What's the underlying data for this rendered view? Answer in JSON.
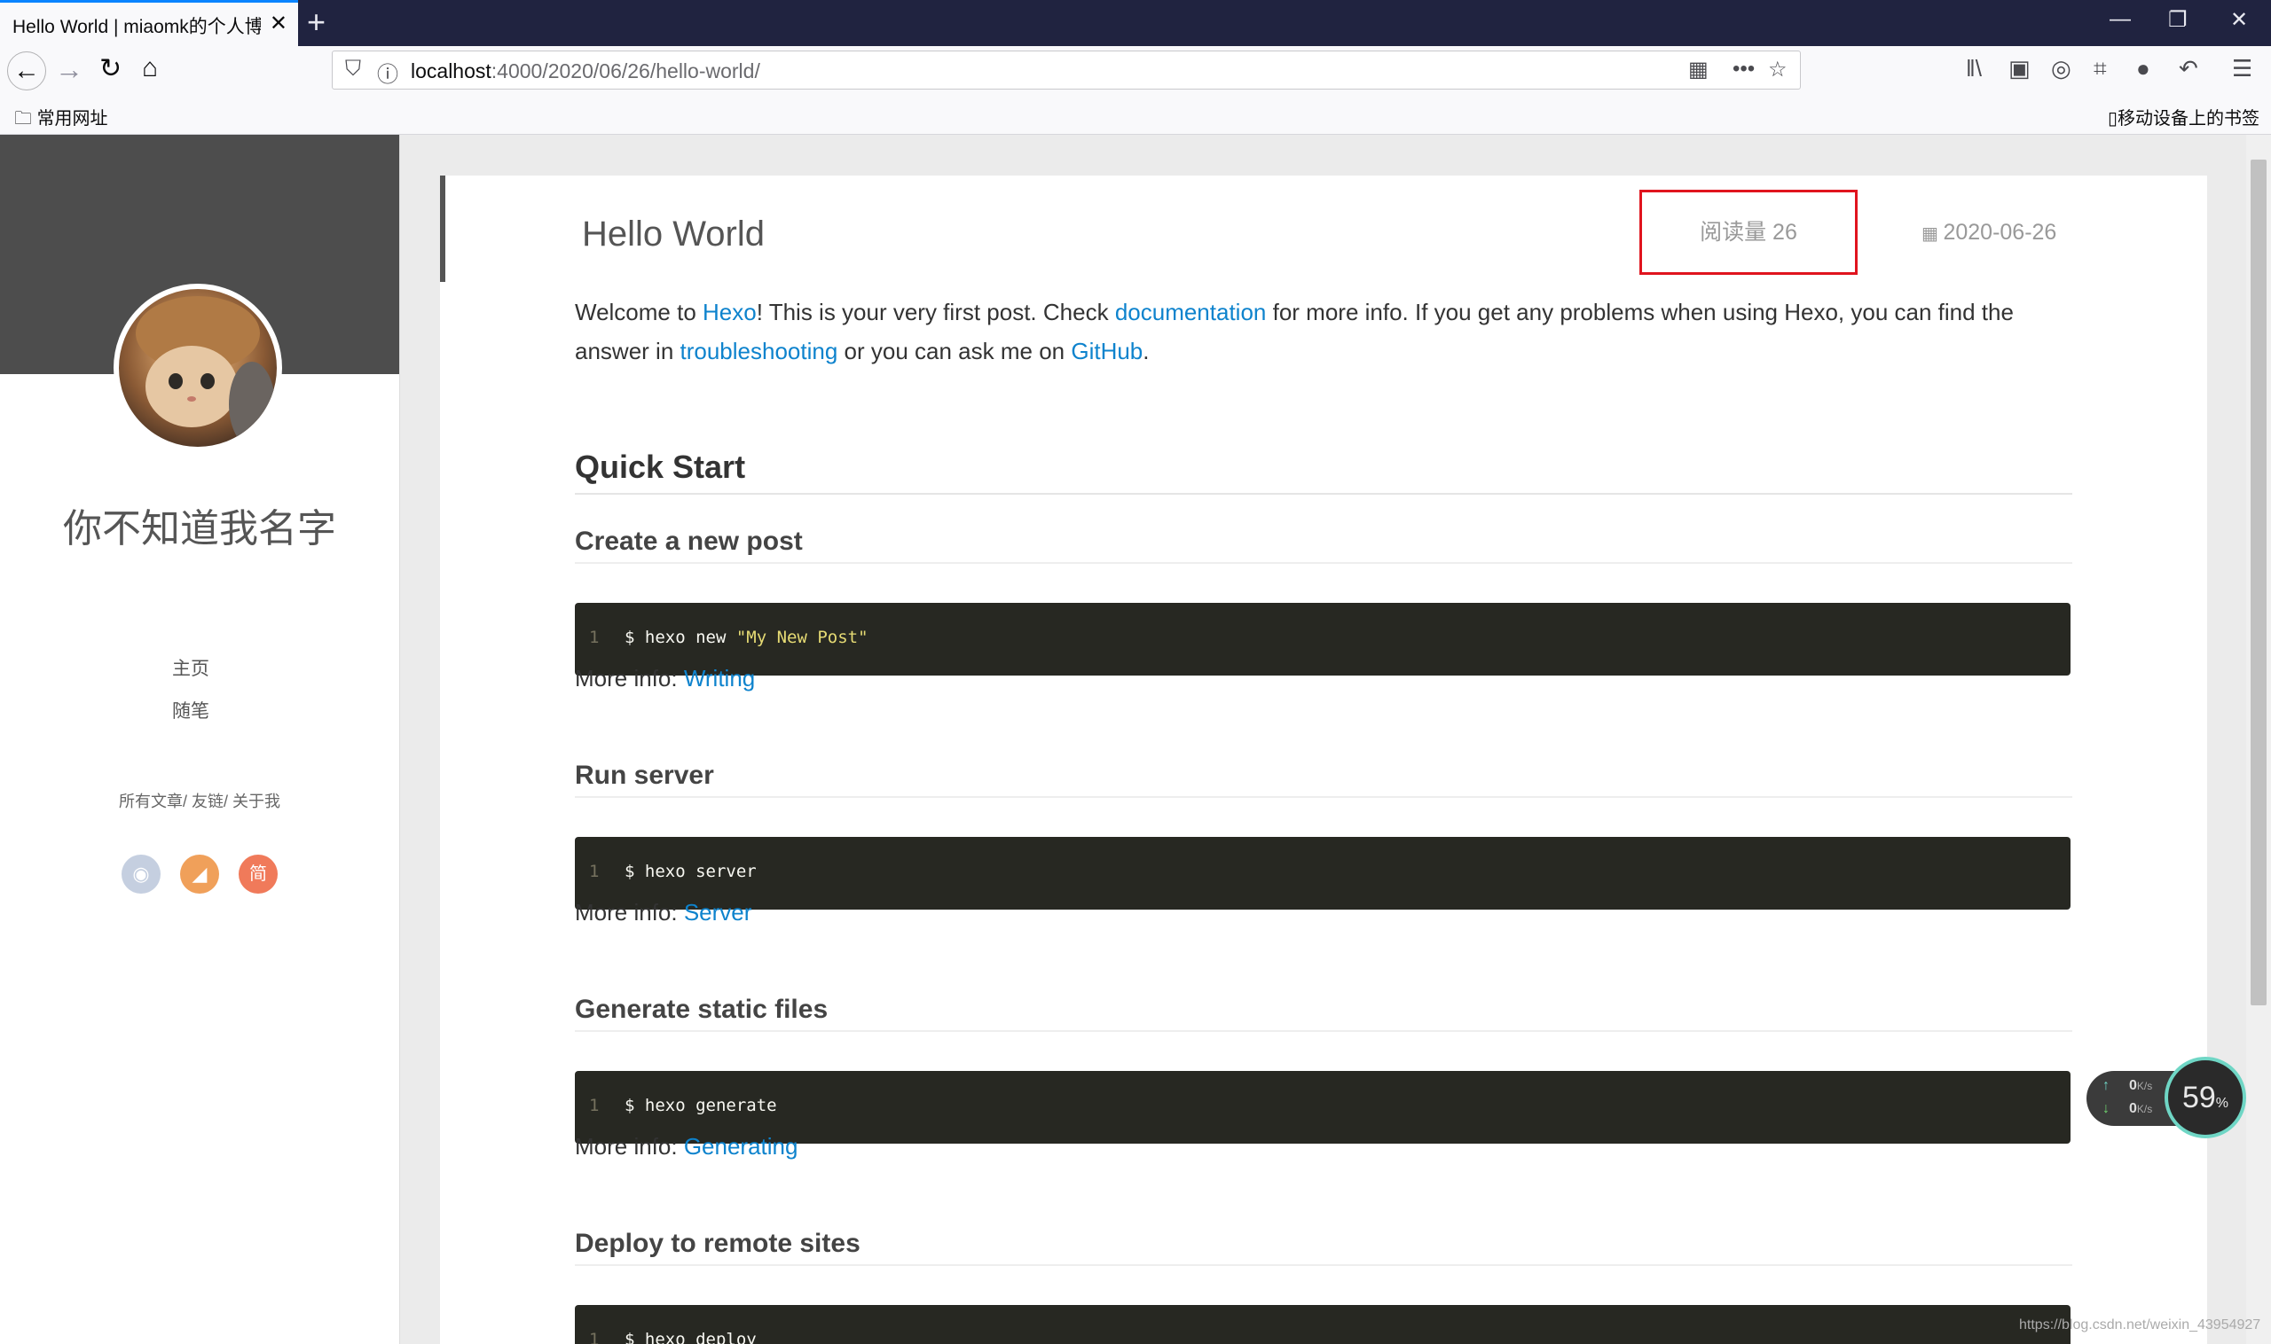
{
  "browser": {
    "tab_title": "Hello World | miaomk的个人博客",
    "tab_close": "✕",
    "new_tab": "+",
    "url_host": "localhost",
    "url_path": ":4000/2020/06/26/hello-world/",
    "bookmark_folder": "常用网址",
    "mobile_bookmarks": "移动设备上的书签"
  },
  "sidebar": {
    "site_name": "你不知道我名字",
    "nav": [
      "主页",
      "随笔"
    ],
    "links": "所有文章/ 友链/ 关于我",
    "social": [
      {
        "icon": "github-icon",
        "color": "#c5cfe0",
        "glyph": "◉"
      },
      {
        "icon": "rss-icon",
        "color": "#f0a05a",
        "glyph": "◢"
      },
      {
        "icon": "jianshu-icon",
        "color": "#f07a5a",
        "glyph": "简"
      }
    ]
  },
  "post": {
    "title": "Hello World",
    "views": "阅读量 26",
    "date": "2020-06-26",
    "intro": {
      "p1": "Welcome to ",
      "link1": "Hexo",
      "p2": "! This is your very first post. Check ",
      "link2": "documentation",
      "p3": " for more info. If you get any problems when using Hexo, you can find the answer in ",
      "link3": "troubleshooting",
      "p4": " or you can ask me on ",
      "link4": "GitHub",
      "p5": "."
    },
    "quick_start": "Quick Start",
    "more_info_label": "More info: ",
    "sections": [
      {
        "heading": "Create a new post",
        "line": "1",
        "cmd": "$ hexo new ",
        "arg": "\"My New Post\"",
        "link": "Writing"
      },
      {
        "heading": "Run server",
        "line": "1",
        "cmd": "$ hexo server",
        "arg": "",
        "link": "Server"
      },
      {
        "heading": "Generate static files",
        "line": "1",
        "cmd": "$ hexo generate",
        "arg": "",
        "link": "Generating"
      },
      {
        "heading": "Deploy to remote sites",
        "line": "1",
        "cmd": "$ hexo deploy",
        "arg": "",
        "link": ""
      }
    ]
  },
  "widget": {
    "percent": "59",
    "percent_unit": "%",
    "up": "0",
    "down": "0",
    "unit": "K/s"
  },
  "watermark": "https://blog.csdn.net/weixin_43954927"
}
